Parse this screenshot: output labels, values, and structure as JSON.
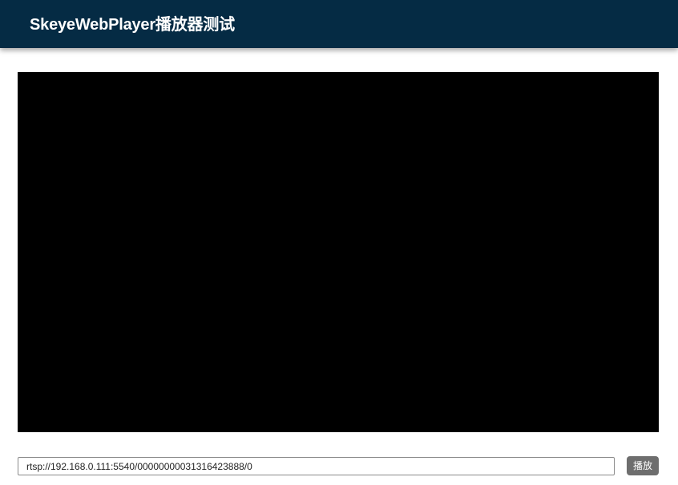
{
  "header": {
    "title": "SkeyeWebPlayer播放器测试",
    "background_color": "#052b44"
  },
  "player": {
    "background_color": "#000000"
  },
  "controls": {
    "url_value": "rtsp://192.168.0.111:5540/00000000031316423888/0",
    "play_label": "播放"
  }
}
